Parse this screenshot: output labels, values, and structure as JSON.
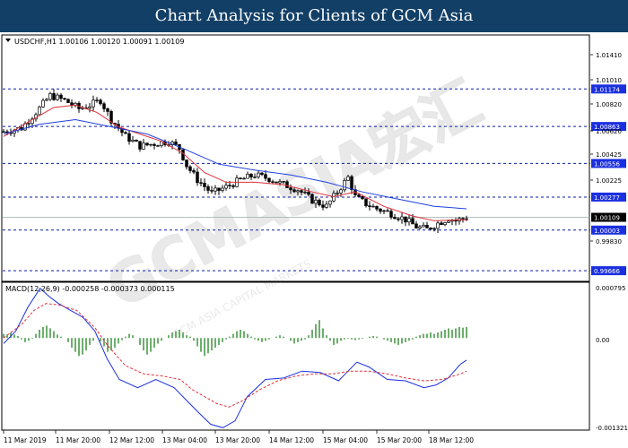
{
  "banner": {
    "title": "Chart Analysis for Clients of GCM Asia"
  },
  "watermark": {
    "text": "GCMASIA宏汇",
    "subtext": "GCM ASIA CAPITAL MARKETS"
  },
  "chart_data": {
    "type": "candlestick",
    "symbol_label": "USDCHF,H1  1.00106 1.00120 1.00091 1.00109",
    "price_panel": {
      "ylim": [
        0.99585,
        1.01615
      ],
      "y_ticks": [
        "1.01410",
        "1.01010",
        "1.00820",
        "1.00620",
        "1.00425",
        "1.00225",
        "0.99830"
      ],
      "level_labels": [
        "1.01174",
        "1.00863",
        "1.00556",
        "1.00277",
        "1.00003",
        "0.99666"
      ],
      "current_price_label": "1.00109",
      "support_resistance": [
        1.01174,
        1.00863,
        1.00556,
        1.00277,
        1.00003,
        0.99666
      ],
      "current_price": 1.00109,
      "candle_count": 130,
      "close_path": [
        [
          0,
          1.0082
        ],
        [
          5,
          1.0085
        ],
        [
          9,
          1.0098
        ],
        [
          13,
          1.0112
        ],
        [
          17,
          1.0108
        ],
        [
          21,
          1.0101
        ],
        [
          24,
          1.0104
        ],
        [
          27,
          1.0108
        ],
        [
          30,
          1.0092
        ],
        [
          34,
          1.0078
        ],
        [
          38,
          1.007
        ],
        [
          42,
          1.0072
        ],
        [
          46,
          1.0074
        ],
        [
          49,
          1.0068
        ],
        [
          51,
          1.0054
        ],
        [
          54,
          1.0042
        ],
        [
          58,
          1.0031
        ],
        [
          62,
          1.0036
        ],
        [
          66,
          1.0042
        ],
        [
          70,
          1.0046
        ],
        [
          74,
          1.0043
        ],
        [
          78,
          1.0038
        ],
        [
          82,
          1.0034
        ],
        [
          86,
          1.0025
        ],
        [
          90,
          1.002
        ],
        [
          93,
          1.0032
        ],
        [
          96,
          1.0044
        ],
        [
          98,
          1.0028
        ],
        [
          101,
          1.0022
        ],
        [
          104,
          1.0018
        ],
        [
          108,
          1.0014
        ],
        [
          112,
          1.0009
        ],
        [
          115,
          1.0003
        ],
        [
          118,
          1.0001
        ],
        [
          121,
          1.0006
        ],
        [
          124,
          1.001
        ],
        [
          126,
          1.0008
        ],
        [
          129,
          1.00109
        ]
      ],
      "red_ma_path": [
        [
          0,
          1.0078
        ],
        [
          8,
          1.0092
        ],
        [
          14,
          1.0102
        ],
        [
          20,
          1.0104
        ],
        [
          26,
          1.0098
        ],
        [
          32,
          1.0086
        ],
        [
          38,
          1.008
        ],
        [
          44,
          1.0074
        ],
        [
          50,
          1.0064
        ],
        [
          56,
          1.0048
        ],
        [
          62,
          1.004
        ],
        [
          70,
          1.004
        ],
        [
          78,
          1.0038
        ],
        [
          86,
          1.0032
        ],
        [
          92,
          1.0028
        ],
        [
          98,
          1.0032
        ],
        [
          106,
          1.002
        ],
        [
          114,
          1.0012
        ],
        [
          120,
          1.0008
        ],
        [
          129,
          1.0009
        ]
      ],
      "blue_ma_path": [
        [
          0,
          1.008
        ],
        [
          10,
          1.0088
        ],
        [
          20,
          1.0092
        ],
        [
          30,
          1.0086
        ],
        [
          40,
          1.008
        ],
        [
          50,
          1.0068
        ],
        [
          60,
          1.0055
        ],
        [
          70,
          1.005
        ],
        [
          80,
          1.0046
        ],
        [
          90,
          1.004
        ],
        [
          100,
          1.0032
        ],
        [
          110,
          1.0026
        ],
        [
          120,
          1.002
        ],
        [
          129,
          1.0018
        ]
      ]
    },
    "macd_panel": {
      "label": "MACD(12,26,9) -0.000258 -0.000373 0.000115",
      "ylim": [
        -0.001321,
        0.000795
      ],
      "y_ticks": [
        "0.000795",
        "0.00",
        "-0.001321"
      ],
      "histogram": [
        6e-05,
        5e-05,
        8e-05,
        5e-05,
        3e-05,
        -2e-05,
        -6e-05,
        -4e-05,
        -1e-05,
        6e-05,
        0.00012,
        0.00016,
        0.00018,
        0.00014,
        0.0001,
        5e-05,
        2e-05,
        0.0,
        -6e-05,
        -0.00014,
        -0.0002,
        -0.00026,
        -0.00024,
        -0.00018,
        -0.0001,
        -4e-05,
        0.0,
        -5e-05,
        -0.00012,
        -0.0002,
        -0.00018,
        -0.00014,
        -8e-05,
        -3e-05,
        2e-05,
        6e-05,
        4e-05,
        0.0,
        -0.0001,
        -0.00018,
        -0.00024,
        -0.0002,
        -0.00014,
        -8e-05,
        -4e-05,
        0.0,
        4e-05,
        8e-05,
        0.0001,
        0.00012,
        8e-05,
        4e-05,
        2e-05,
        -4e-05,
        -0.00012,
        -0.0002,
        -0.00026,
        -0.00022,
        -0.00018,
        -0.00014,
        -0.0001,
        -6e-05,
        -2e-05,
        2e-05,
        6e-05,
        0.0001,
        0.00012,
        0.0001,
        6e-05,
        2e-05,
        -2e-05,
        -4e-05,
        -6e-05,
        -4e-05,
        -2e-05,
        0.0,
        2e-05,
        4e-05,
        2e-05,
        0.0,
        -4e-05,
        -8e-05,
        -6e-05,
        -4e-05,
        -2e-05,
        4e-05,
        0.00012,
        0.0002,
        0.00026,
        0.00014,
        4e-05,
        -4e-05,
        -0.0001,
        -8e-05,
        -4e-05,
        -2e-05,
        -1e-05,
        -2e-05,
        -3e-05,
        -2e-05,
        -1e-05,
        0.0,
        2e-05,
        3e-05,
        2e-05,
        0.0,
        -2e-05,
        -4e-05,
        -6e-05,
        -8e-05,
        -0.0001,
        -8e-05,
        -6e-05,
        -4e-05,
        -2e-05,
        2e-05,
        4e-05,
        6e-05,
        6e-05,
        8e-05,
        6e-05,
        8e-05,
        0.0001,
        0.00012,
        0.00014,
        0.00012,
        0.00014,
        0.00016,
        0.00015,
        0.00016
      ],
      "macd_path": [
        [
          0,
          -8e-05
        ],
        [
          4,
          0.0001
        ],
        [
          8,
          0.00045
        ],
        [
          12,
          0.00072
        ],
        [
          15,
          0.0006
        ],
        [
          18,
          0.0005
        ],
        [
          22,
          0.0004
        ],
        [
          26,
          0.0003
        ],
        [
          30,
          0.0001
        ],
        [
          34,
          -0.0003
        ],
        [
          38,
          -0.0006
        ],
        [
          44,
          -0.00072
        ],
        [
          50,
          -0.0006
        ],
        [
          56,
          -0.00072
        ],
        [
          60,
          -0.0009
        ],
        [
          64,
          -0.00108
        ],
        [
          68,
          -0.00125
        ],
        [
          72,
          -0.0013
        ],
        [
          76,
          -0.0012
        ],
        [
          80,
          -0.00085
        ],
        [
          86,
          -0.0006
        ],
        [
          92,
          -0.00058
        ],
        [
          98,
          -0.00048
        ],
        [
          104,
          -0.0005
        ],
        [
          110,
          -0.00062
        ],
        [
          116,
          -0.00035
        ],
        [
          120,
          -0.00042
        ],
        [
          126,
          -0.0006
        ],
        [
          132,
          -0.00062
        ],
        [
          138,
          -0.00072
        ],
        [
          142,
          -0.00068
        ],
        [
          146,
          -0.00058
        ],
        [
          150,
          -0.00038
        ],
        [
          152,
          -0.00032
        ]
      ],
      "signal_path": [
        [
          0,
          0.0
        ],
        [
          6,
          0.0002
        ],
        [
          10,
          0.0004
        ],
        [
          14,
          0.0005
        ],
        [
          18,
          0.00048
        ],
        [
          24,
          0.0004
        ],
        [
          30,
          0.00015
        ],
        [
          34,
          -0.0001
        ],
        [
          40,
          -0.0004
        ],
        [
          46,
          -0.00052
        ],
        [
          52,
          -0.00055
        ],
        [
          58,
          -0.0006
        ],
        [
          62,
          -0.00075
        ],
        [
          66,
          -0.00085
        ],
        [
          70,
          -0.00095
        ],
        [
          74,
          -0.001
        ],
        [
          78,
          -0.00092
        ],
        [
          84,
          -0.00075
        ],
        [
          90,
          -0.00062
        ],
        [
          96,
          -0.00055
        ],
        [
          102,
          -0.00052
        ],
        [
          108,
          -0.00052
        ],
        [
          114,
          -0.00048
        ],
        [
          120,
          -0.00048
        ],
        [
          126,
          -0.00052
        ],
        [
          132,
          -0.00058
        ],
        [
          138,
          -0.00062
        ],
        [
          144,
          -0.0006
        ],
        [
          150,
          -0.00052
        ],
        [
          152,
          -0.00048
        ]
      ]
    },
    "x_ticks": [
      "11 Mar 2019",
      "11 Mar 20:00",
      "12 Mar 12:00",
      "13 Mar 04:00",
      "13 Mar 20:00",
      "14 Mar 12:00",
      "15 Mar 04:00",
      "15 Mar 20:00",
      "18 Mar 12:00"
    ],
    "colors": {
      "banner": "#123f66",
      "level_line": "#0a1fa8",
      "level_box": "#1a2fe0",
      "candle": "#000000",
      "red_ma": "#e0303a",
      "blue_ma": "#2040e0",
      "histogram": "#2e8b2e",
      "macd_line": "#1a2fe0",
      "signal_line": "#e0303a",
      "current_box": "#000000"
    }
  }
}
